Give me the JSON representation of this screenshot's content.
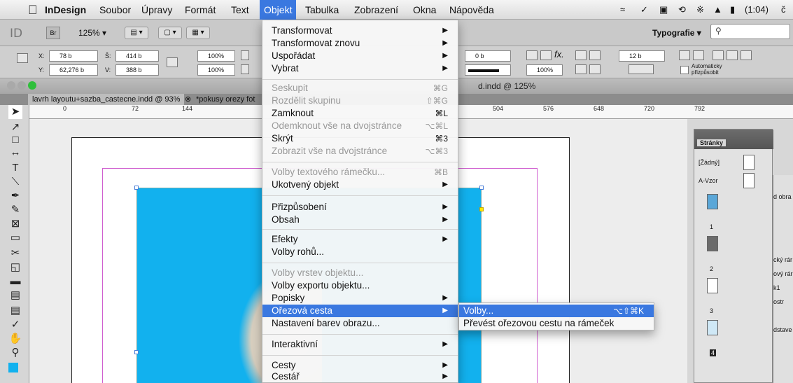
{
  "menubar": {
    "app": "InDesign",
    "items": [
      "Soubor",
      "Úpravy",
      "Formát",
      "Text",
      "Objekt",
      "Tabulka",
      "Zobrazení",
      "Okna",
      "Nápověda"
    ],
    "active": "Objekt",
    "battery": "(1:04)",
    "clock_fragment": "č"
  },
  "control": {
    "logo": "ID",
    "bridge": "Br",
    "zoom": "125% ▾",
    "workspace": "Typografie ▾",
    "search_placeholder": "",
    "x_label": "X:",
    "x_value": "78 b",
    "y_label": "Y:",
    "y_value": "62,276 b",
    "w_label": "Š:",
    "w_value": "414 b",
    "h_label": "V:",
    "h_value": "388 b",
    "scale_x": "100%",
    "scale_y": "100%",
    "stroke_value": "0 b",
    "opacity": "100%",
    "col_width": "12 b",
    "autofit": "Automaticky přizpůsobit"
  },
  "document": {
    "title": "d.indd @ 125%",
    "tabs": [
      "lavrh layoutu+sazba_castecne.indd @ 93%",
      "*pokusy orezy fot"
    ],
    "ruler_ticks": [
      "0",
      "72",
      "144",
      "504",
      "576",
      "648",
      "720",
      "792"
    ]
  },
  "menu": {
    "rows": [
      {
        "label": "Transformovat",
        "arrow": true
      },
      {
        "label": "Transformovat znovu",
        "arrow": true
      },
      {
        "label": "Uspořádat",
        "arrow": true
      },
      {
        "label": "Vybrat",
        "arrow": true
      },
      {
        "label": "Seskupit",
        "shortcut": "⌘G",
        "disabled": true
      },
      {
        "label": "Rozdělit skupinu",
        "shortcut": "⇧⌘G",
        "disabled": true
      },
      {
        "label": "Zamknout",
        "shortcut": "⌘L"
      },
      {
        "label": "Odemknout vše na dvojstránce",
        "shortcut": "⌥⌘L",
        "disabled": true
      },
      {
        "label": "Skrýt",
        "shortcut": "⌘3"
      },
      {
        "label": "Zobrazit vše na dvojstránce",
        "shortcut": "⌥⌘3",
        "disabled": true
      },
      {
        "label": "Volby textového rámečku...",
        "shortcut": "⌘B",
        "disabled": true
      },
      {
        "label": "Ukotvený objekt",
        "arrow": true
      },
      {
        "label": "Přizpůsobení",
        "arrow": true
      },
      {
        "label": "Obsah",
        "arrow": true
      },
      {
        "label": "Efekty",
        "arrow": true
      },
      {
        "label": "Volby rohů..."
      },
      {
        "label": "Volby vrstev objektu...",
        "disabled": true
      },
      {
        "label": "Volby exportu objektu..."
      },
      {
        "label": "Popisky",
        "arrow": true
      },
      {
        "label": "Ořezová cesta",
        "arrow": true,
        "highlighted": true
      },
      {
        "label": "Nastavení barev obrazu..."
      },
      {
        "label": "Interaktivní",
        "arrow": true
      },
      {
        "label": "Cesty",
        "arrow": true
      },
      {
        "label": "Cestář",
        "arrow": true
      }
    ]
  },
  "submenu": {
    "rows": [
      {
        "label": "Volby...",
        "shortcut": "⌥⇧⌘K",
        "highlighted": true
      },
      {
        "label": "Převést ořezovou cestu na rámeček"
      }
    ]
  },
  "pages_panel": {
    "title": "Stránky",
    "none": "[Žádný]",
    "master": "A-Vzor",
    "page_numbers": [
      "1",
      "2",
      "3",
      "4"
    ]
  },
  "side_strip": {
    "items": [
      "d obra",
      "cký rár",
      "ový rár",
      "k1",
      "ostr",
      "dstave"
    ]
  }
}
